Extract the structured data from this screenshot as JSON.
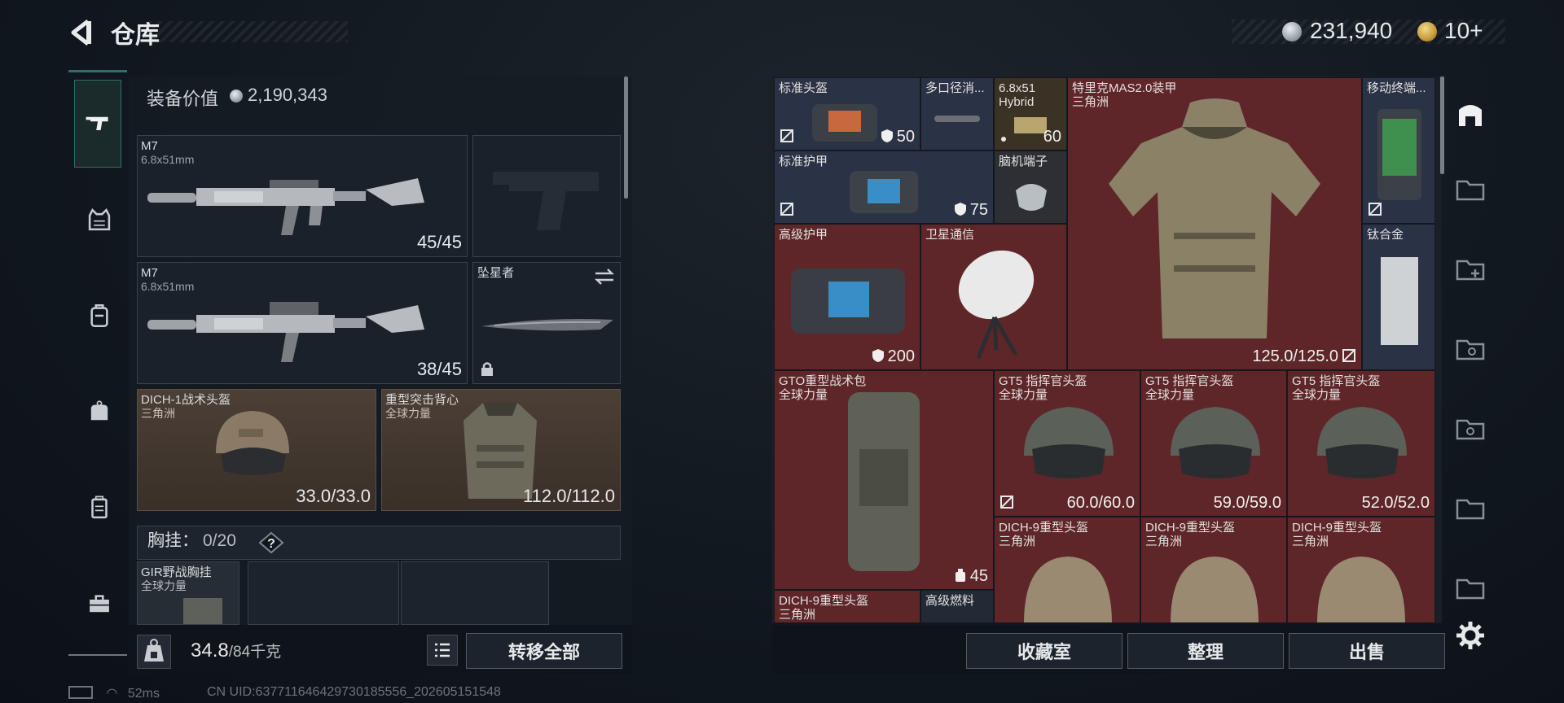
{
  "top_bar": {
    "title": "仓库",
    "money": "231,940",
    "tokens": "10+"
  },
  "equipment": {
    "header_label": "装备价值",
    "header_value": "2,190,343",
    "primary_1": {
      "name": "M7",
      "caliber": "6.8x51mm",
      "ammo": "45/45"
    },
    "primary_2": {
      "name": "M7",
      "caliber": "6.8x51mm",
      "ammo": "38/45"
    },
    "melee": {
      "name": "坠星者"
    },
    "helmet": {
      "name": "DICH-1战术头盔",
      "faction": "三角洲",
      "durability": "33.0/33.0"
    },
    "armor": {
      "name": "重型突击背心",
      "faction": "全球力量",
      "durability": "112.0/112.0"
    },
    "chest_rig": {
      "label": "胸挂：",
      "count": "0/20",
      "help": "?"
    },
    "chest_item": {
      "name": "GIR野战胸挂",
      "faction": "全球力量"
    },
    "weight": "34.8",
    "weight_cap": "/84千克",
    "transfer_all": "转移全部"
  },
  "storage": {
    "items": [
      {
        "name": "标准头盔",
        "value": "50"
      },
      {
        "name": "多口径消..."
      },
      {
        "name": "6.8x51",
        "name2": "Hybrid",
        "value": "60"
      },
      {
        "name": "特里克MAS2.0装甲",
        "faction": "三角洲",
        "value": "125.0/125.0"
      },
      {
        "name": "移动终端..."
      },
      {
        "name": "标准护甲",
        "value": "75"
      },
      {
        "name": "脑机端子"
      },
      {
        "name": "高级护甲",
        "value": "200"
      },
      {
        "name": "卫星通信"
      },
      {
        "name": "钛合金"
      },
      {
        "name": "GTO重型战术包",
        "faction": "全球力量",
        "value": "45"
      },
      {
        "name": "GT5 指挥官头盔",
        "faction": "全球力量",
        "value": "60.0/60.0"
      },
      {
        "name": "GT5 指挥官头盔",
        "faction": "全球力量",
        "value": "59.0/59.0"
      },
      {
        "name": "GT5 指挥官头盔",
        "faction": "全球力量",
        "value": "52.0/52.0"
      },
      {
        "name": "DICH-9重型头盔",
        "faction": "三角洲"
      },
      {
        "name": "DICH-9重型头盔",
        "faction": "三角洲"
      },
      {
        "name": "DICH-9重型头盔",
        "faction": "三角洲"
      },
      {
        "name": "DICH-9重型头盔",
        "faction": "三角洲"
      },
      {
        "name": "高级燃料"
      }
    ],
    "buttons": {
      "collection": "收藏室",
      "organize": "整理",
      "sell": "出售"
    }
  },
  "status_bar": {
    "ping": "52ms",
    "uid": "CN UID:637711646429730185556_202605151548"
  },
  "colors": {
    "accent_teal": "#2e7069",
    "cell_red": "#5e2629",
    "cell_navy": "#2a3246",
    "slot_brown": "#4b3f36"
  },
  "icons": [
    "back-arrow-icon",
    "pistol-icon",
    "vest-icon",
    "backpack-icon",
    "bag-icon",
    "case-icon",
    "toolbox-icon",
    "lock-icon",
    "scale-icon",
    "list-icon",
    "settings-icon",
    "safe-icon"
  ]
}
